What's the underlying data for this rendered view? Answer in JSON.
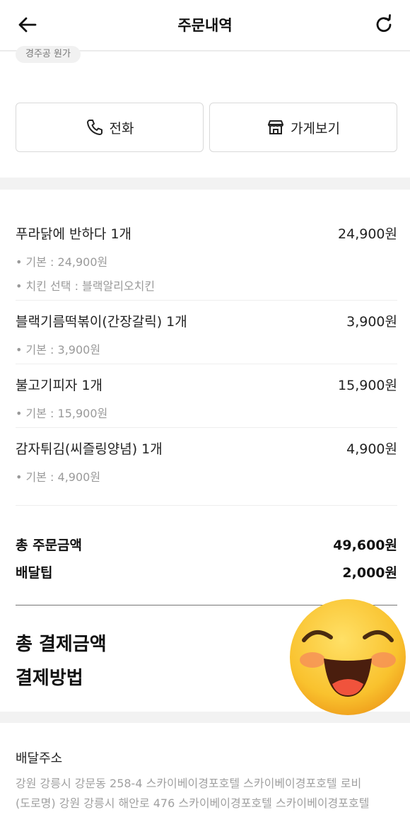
{
  "header": {
    "title": "주문내역",
    "back_icon": "back-arrow-icon",
    "refresh_icon": "refresh-icon"
  },
  "store_card": {
    "chip_text": "경주공 원가",
    "call_label": "전화",
    "store_label": "가게보기",
    "call_icon": "phone-icon",
    "store_icon": "store-icon"
  },
  "items": [
    {
      "name": "푸라닭에 반하다 1개",
      "price": "24,900원",
      "options": [
        "• 기본 : 24,900원",
        "• 치킨 선택 : 블랙알리오치킨"
      ]
    },
    {
      "name": "블랙기름떡볶이(간장갈릭) 1개",
      "price": "3,900원",
      "options": [
        "• 기본 : 3,900원"
      ]
    },
    {
      "name": "불고기피자 1개",
      "price": "15,900원",
      "options": [
        "• 기본 : 15,900원"
      ]
    },
    {
      "name": "감자튀김(씨즐링양념) 1개",
      "price": "4,900원",
      "options": [
        "• 기본 : 4,900원"
      ]
    }
  ],
  "summary": {
    "order_total_label": "총 주문금액",
    "order_total_value": "49,600원",
    "delivery_tip_label": "배달팁",
    "delivery_tip_value": "2,000원",
    "payment_total_label": "총 결제금액",
    "payment_method_label": "결제방법"
  },
  "address": {
    "title": "배달주소",
    "line1": "강원 강릉시 강문동 258-4 스카이베이경포호텔 스카이베이경포호텔 로비",
    "line2": "(도로명) 강원 강릉시 해안로 476 스카이베이경포호텔 스카이베이경포호텔"
  },
  "colors": {
    "background": "#f2f2f2",
    "card": "#ffffff",
    "muted_text": "#9a9a9a",
    "emoji_face": "#f9c22e"
  },
  "overlay": {
    "emoji_icon": "grinning-face-emoji-icon"
  }
}
